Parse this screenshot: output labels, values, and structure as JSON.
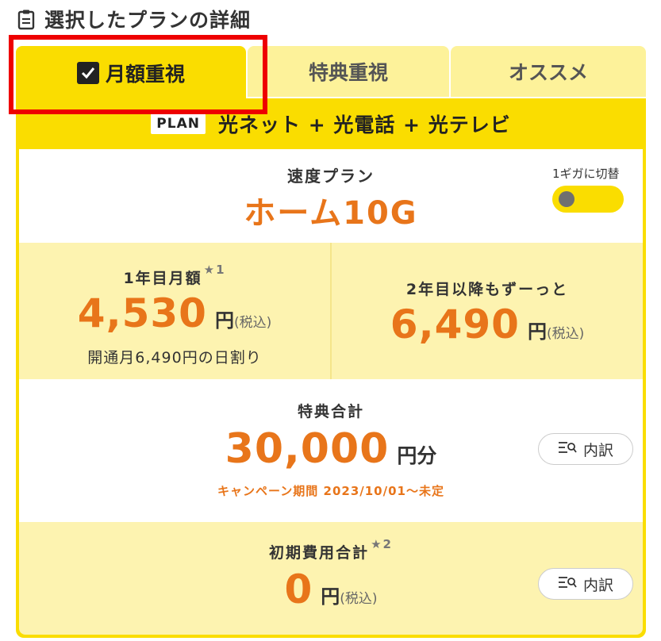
{
  "header": {
    "title": "選択したプランの詳細",
    "icon": "clipboard-icon"
  },
  "tabs": [
    {
      "label": "月額重視",
      "active": true
    },
    {
      "label": "特典重視",
      "active": false
    },
    {
      "label": "オススメ",
      "active": false
    }
  ],
  "plan": {
    "badge": "PLAN",
    "name": "光ネット + 光電話 + 光テレビ"
  },
  "speed": {
    "label": "速度プラン",
    "value": "ホーム10G",
    "toggle_label": "1ギガに切替"
  },
  "price_first_year": {
    "label": "1年目月額",
    "star": "★1",
    "amount": "4,530",
    "unit": "円",
    "tax": "(税込)",
    "note": "開通月6,490円の日割り"
  },
  "price_after": {
    "label": "2年目以降もずーっと",
    "amount": "6,490",
    "unit": "円",
    "tax": "(税込)"
  },
  "benefit": {
    "label": "特典合計",
    "amount": "30,000",
    "unit": "円分",
    "campaign": "キャンペーン期間 2023/10/01〜未定",
    "breakdown_label": "内訳"
  },
  "initial_cost": {
    "label": "初期費用合計",
    "star": "★2",
    "amount": "0",
    "unit": "円",
    "tax": "(税込)",
    "breakdown_label": "内訳"
  },
  "colors": {
    "accent": "#fadd00",
    "accent_light": "#fdf3b0",
    "orange": "#e8751a",
    "highlight": "#ee0000"
  }
}
